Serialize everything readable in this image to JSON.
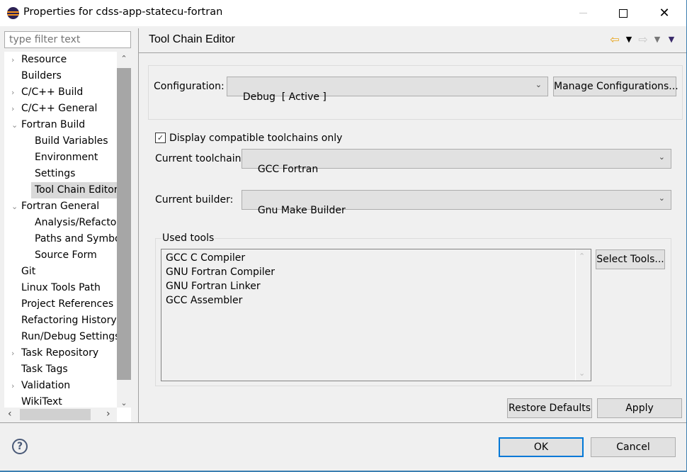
{
  "window": {
    "title": "Properties for cdss-app-statecu-fortran",
    "icon": "eclipse-icon",
    "controls": {
      "minimize": "minimize",
      "maximize": "maximize",
      "close": "✕"
    }
  },
  "sidebar": {
    "filter_placeholder": "type filter text",
    "filter_value": "",
    "items": [
      {
        "label": "Resource",
        "level": 0,
        "twisty": "›"
      },
      {
        "label": "Builders",
        "level": 0,
        "twisty": ""
      },
      {
        "label": "C/C++ Build",
        "level": 0,
        "twisty": "›"
      },
      {
        "label": "C/C++ General",
        "level": 0,
        "twisty": "›"
      },
      {
        "label": "Fortran Build",
        "level": 0,
        "twisty": "⌄"
      },
      {
        "label": "Build Variables",
        "level": 1,
        "twisty": ""
      },
      {
        "label": "Environment",
        "level": 1,
        "twisty": ""
      },
      {
        "label": "Settings",
        "level": 1,
        "twisty": ""
      },
      {
        "label": "Tool Chain Editor",
        "level": 1,
        "twisty": "",
        "selected": true
      },
      {
        "label": "Fortran General",
        "level": 0,
        "twisty": "⌄"
      },
      {
        "label": "Analysis/Refactor",
        "level": 1,
        "twisty": ""
      },
      {
        "label": "Paths and Symbol",
        "level": 1,
        "twisty": ""
      },
      {
        "label": "Source Form",
        "level": 1,
        "twisty": ""
      },
      {
        "label": "Git",
        "level": 0,
        "twisty": ""
      },
      {
        "label": "Linux Tools Path",
        "level": 0,
        "twisty": ""
      },
      {
        "label": "Project References",
        "level": 0,
        "twisty": ""
      },
      {
        "label": "Refactoring History",
        "level": 0,
        "twisty": ""
      },
      {
        "label": "Run/Debug Settings",
        "level": 0,
        "twisty": ""
      },
      {
        "label": "Task Repository",
        "level": 0,
        "twisty": "›"
      },
      {
        "label": "Task Tags",
        "level": 0,
        "twisty": ""
      },
      {
        "label": "Validation",
        "level": 0,
        "twisty": "›"
      },
      {
        "label": "WikiText",
        "level": 0,
        "twisty": ""
      }
    ],
    "scroll": {
      "up": "⌃",
      "down": "⌄",
      "left": "‹",
      "right": "›"
    }
  },
  "page": {
    "title": "Tool Chain Editor",
    "nav": {
      "back": "⇦",
      "forward": "⇨",
      "menu": "▼"
    },
    "configuration": {
      "label": "Configuration:",
      "value": "Debug  [ Active ]",
      "manage_button": "Manage Configurations..."
    },
    "display_compatible": {
      "label": "Display compatible toolchains only",
      "checked": true,
      "check_glyph": "✓"
    },
    "toolchain": {
      "label": "Current toolchain:",
      "value": "GCC Fortran"
    },
    "builder": {
      "label": "Current builder:",
      "value": "Gnu Make Builder"
    },
    "used_tools": {
      "title": "Used tools",
      "items": [
        "GCC C Compiler",
        "GNU Fortran Compiler",
        "GNU Fortran Linker",
        "GCC Assembler"
      ],
      "select_button": "Select Tools..."
    },
    "restore_defaults": "Restore Defaults",
    "apply": "Apply"
  },
  "footer": {
    "help": "?",
    "ok": "OK",
    "cancel": "Cancel"
  },
  "colors": {
    "accent": "#0078d7",
    "selection": "#d9d9d9",
    "back_arrow": "#e8a317"
  }
}
